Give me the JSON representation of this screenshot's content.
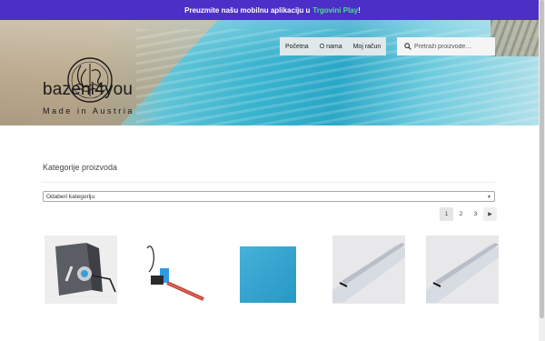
{
  "topbar": {
    "text": "Preuzmite našu mobilnu aplikaciju u",
    "link": "Trgovini Play",
    "suffix": "!"
  },
  "site": {
    "brand": "bazeni4you",
    "tagline": "Made in Austria"
  },
  "nav": {
    "items": [
      "Početna",
      "O nama",
      "Moj račun"
    ]
  },
  "search": {
    "placeholder": "Pretraži proizvode…"
  },
  "categories": {
    "title": "Kategorije proizvoda",
    "select_value": "Odaberi kategoriju"
  },
  "pagination": {
    "pages": [
      "1",
      "2",
      "3"
    ],
    "current": "1",
    "next": "→"
  },
  "products": [
    {
      "image": "pool-lamp-housing-photo"
    },
    {
      "image": "pool-skimmer-cable-photo"
    },
    {
      "image": "blue-tile-photo"
    },
    {
      "image": "pvc-corner-profile-photo"
    },
    {
      "image": "pvc-corner-profile-photo"
    }
  ],
  "colors": {
    "topbar": "#4b2fc7",
    "topbar_link": "#4fe08a",
    "text": "#43454b"
  }
}
